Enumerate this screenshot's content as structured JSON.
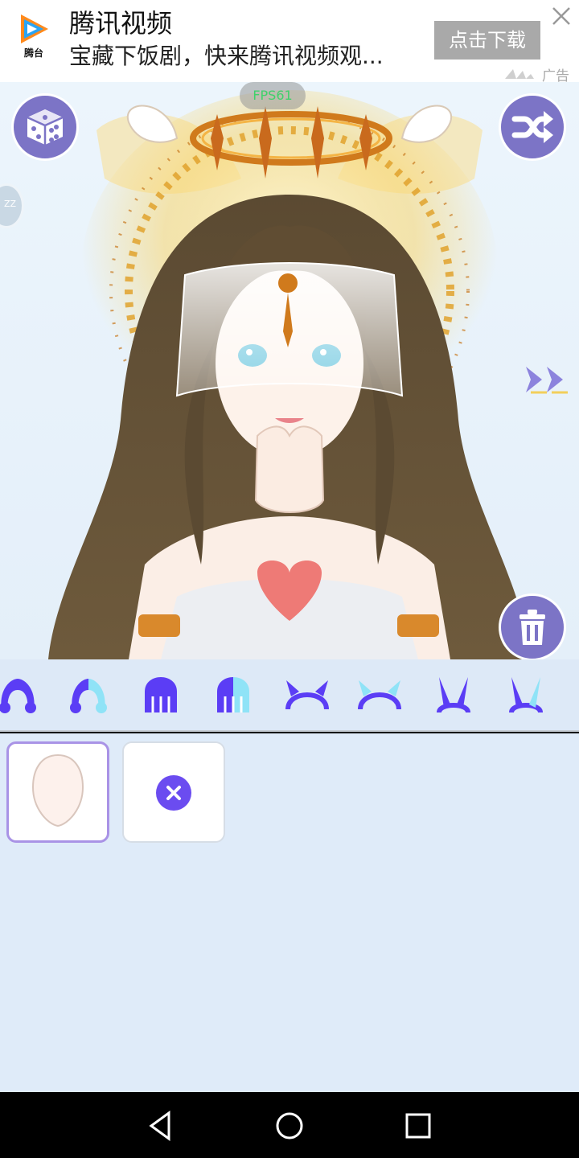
{
  "ad": {
    "logo_caption": "腾台",
    "title": "腾讯视频",
    "subtitle": "宝藏下饭剧，快来腾讯视频观...",
    "cta_label": "点击下载",
    "ad_label": "广告"
  },
  "stage": {
    "fps_text": "FPS61",
    "side_tab_text": "ZZ"
  },
  "categories": [
    {
      "icon": "hair-icon",
      "active": false
    },
    {
      "icon": "hair-two-tone-icon",
      "active": false
    },
    {
      "icon": "hair-back-icon",
      "active": false
    },
    {
      "icon": "hair-back-two-tone-icon",
      "active": false
    },
    {
      "icon": "horns-headband-icon",
      "active": false
    },
    {
      "icon": "horns-headband-two-tone-icon",
      "active": false
    },
    {
      "icon": "bunny-ears-icon",
      "active": false
    },
    {
      "icon": "bunny-ears-two-tone-icon",
      "active": false
    }
  ],
  "items": [
    {
      "name": "face-shape",
      "selected": true
    },
    {
      "name": "none",
      "selected": false
    }
  ],
  "colors": {
    "accent": "#6b4cf0",
    "button": "#7c74c6",
    "strip_bg": "#dde9f7",
    "panel_bg": "#dfebf9",
    "selected_border": "#a993e6"
  }
}
